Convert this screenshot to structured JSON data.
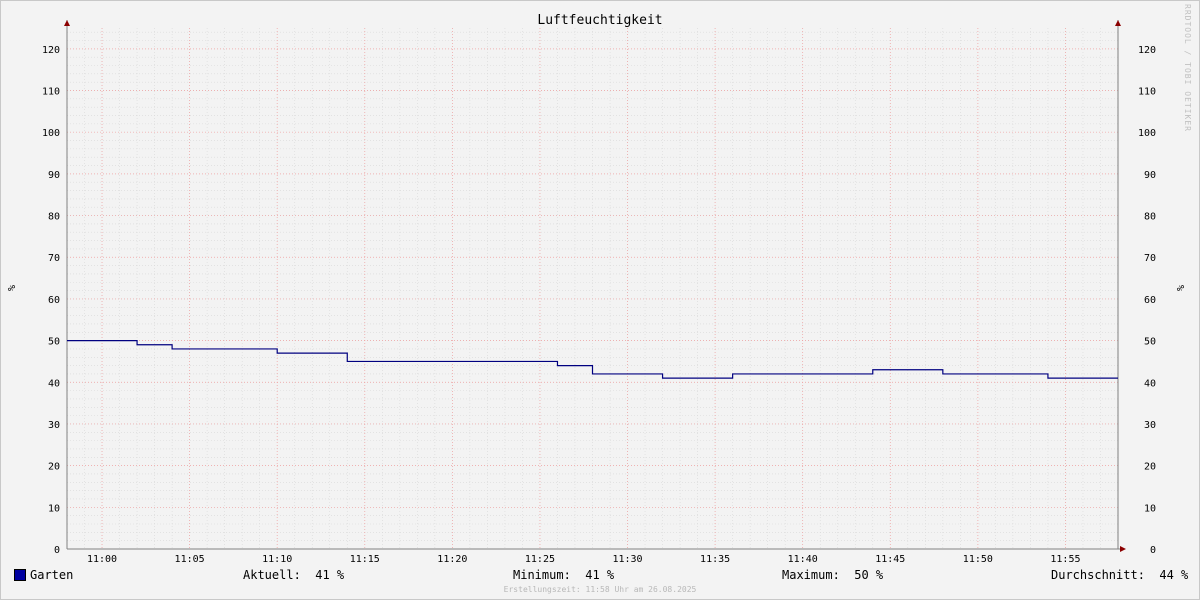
{
  "watermark": "RRDTOOL / TOBI OETIKER",
  "colors": {
    "series": "#000080",
    "swatch": "#0000a0",
    "major_grid": "#f0a0a0",
    "minor_grid": "#d8d8d8",
    "axis": "#808080",
    "arrow": "#8b0000"
  },
  "chart_data": {
    "type": "line",
    "title": "Luftfeuchtigkeit",
    "ylabel": "%",
    "ylabel_right": "%",
    "ylim": [
      0,
      125
    ],
    "yticks": [
      0,
      10,
      20,
      30,
      40,
      50,
      60,
      70,
      80,
      90,
      100,
      110,
      120
    ],
    "x_start": "10:58",
    "x_end": "11:58",
    "xticks": [
      "11:00",
      "11:05",
      "11:10",
      "11:15",
      "11:20",
      "11:25",
      "11:30",
      "11:35",
      "11:40",
      "11:45",
      "11:50",
      "11:55"
    ],
    "grid": true,
    "step": true,
    "series": [
      {
        "name": "Garten",
        "points": [
          [
            "10:58",
            50
          ],
          [
            "11:02",
            49
          ],
          [
            "11:04",
            48
          ],
          [
            "11:10",
            47
          ],
          [
            "11:14",
            45
          ],
          [
            "11:26",
            44
          ],
          [
            "11:28",
            42
          ],
          [
            "11:32",
            41
          ],
          [
            "11:36",
            42
          ],
          [
            "11:44",
            43
          ],
          [
            "11:48",
            42
          ],
          [
            "11:54",
            41
          ],
          [
            "11:58",
            41
          ]
        ]
      }
    ]
  },
  "legend": {
    "series_name": "Garten",
    "aktuell": "Aktuell:  41 %",
    "minimum": "Minimum:  41 %",
    "maximum": "Maximum:  50 %",
    "durchschnitt": "Durchschnitt:  44 %"
  },
  "footer": "Erstellungszeit: 11:58 Uhr am 26.08.2025"
}
